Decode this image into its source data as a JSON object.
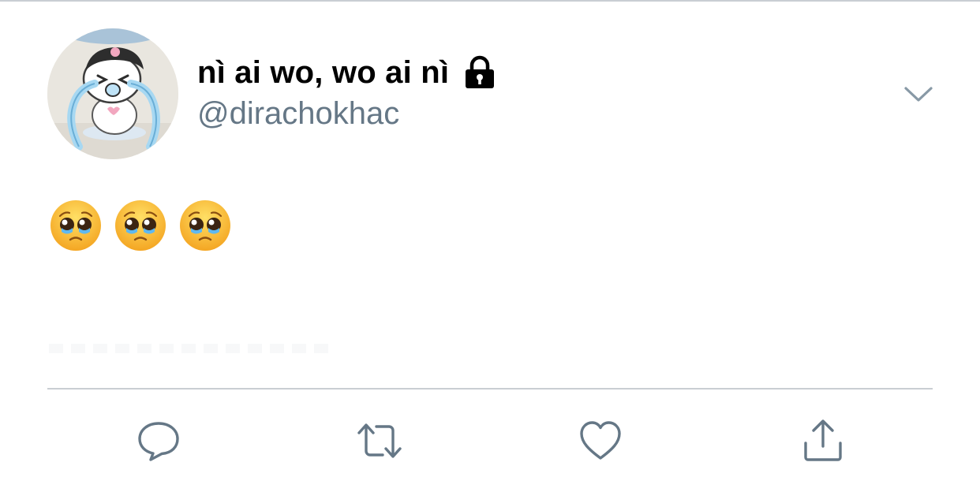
{
  "tweet": {
    "author": {
      "display_name": "nì ai wo, wo ai nì",
      "handle": "@dirachokhac",
      "protected": true,
      "avatar_icon": "avatar-crying-cartoon"
    },
    "text": [
      "🥺",
      "🥺",
      "🥺"
    ],
    "menu_icon": "chevron-down-icon"
  },
  "actions": [
    {
      "name": "reply",
      "icon": "comment-bubble-icon"
    },
    {
      "name": "retweet",
      "icon": "retweet-icon"
    },
    {
      "name": "like",
      "icon": "heart-icon"
    },
    {
      "name": "share",
      "icon": "share-upload-icon"
    }
  ],
  "colors": {
    "text_primary": "#000000",
    "text_secondary": "#657786",
    "icon": "#657786",
    "divider": "#c9ced3"
  }
}
